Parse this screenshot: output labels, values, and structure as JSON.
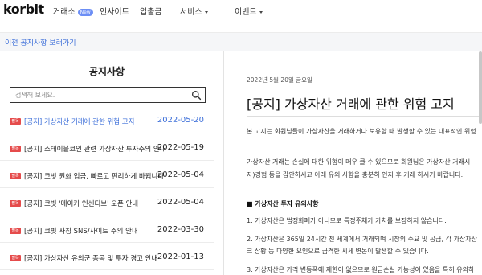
{
  "nav": {
    "logo": "korbit",
    "items": [
      {
        "label": "거래소",
        "badge": "New"
      },
      {
        "label": "인사이트"
      },
      {
        "label": "입출금"
      },
      {
        "label": "서비스"
      },
      {
        "label": "이벤트"
      }
    ]
  },
  "subbar": {
    "back_link": "이전 공지사항 보러가기"
  },
  "sidebar": {
    "title": "공지사항",
    "search_placeholder": "검색해 보세요.",
    "search_value": "",
    "items": [
      {
        "tag": "필독",
        "title": "[공지] 가상자산 거래에 관한 위험 고지",
        "date": "2022-05-20",
        "active": true
      },
      {
        "tag": "필독",
        "title": "[공지] 스테이블코인 관련 가상자산 투자주의 안내",
        "date": "2022-05-19"
      },
      {
        "tag": "필독",
        "title": "[공지] 코빗 원화 입금, 빠르고 편리하게 바뀝니다.",
        "date": "2022-05-04"
      },
      {
        "tag": "필독",
        "title": "[공지] 코빗 '메이커 인센티브' 오픈 안내",
        "date": "2022-05-04"
      },
      {
        "tag": "필독",
        "title": "[공지] 코빗 사칭 SNS/사이트 주의 안내",
        "date": "2022-03-30"
      },
      {
        "tag": "필독",
        "title": "[공지] 가상자산 유의군 종목 및 투자 경고 안내",
        "date": "2022-01-13"
      }
    ]
  },
  "post": {
    "date": "2022년 5월 20일 금요일",
    "title": "[공지] 가상자산 거래에 관한 위험 고지",
    "paragraphs": [
      "본 고지는 회원님들이 가상자산을 거래하거나 보유할 때 발생할 수 있는 대표적인 위험",
      "가상자산 거래는 손실에 대한 위험이 매우 클 수 있으므로 회원님은 가상자산 거래시",
      "자)경험 등을 감안하시고 아래 유의 사항을 충분히 인지 후 거래 하시기 바랍니다.",
      "■ 가상자산 투자 유의사항",
      "1. 가상자산은 법정화폐가 아니므로 특정주체가 가치를 보장하지 않습니다.",
      "2. 가상자산은 365일 24시간 전 세계에서 거래되며 시장의 수요 및 공급, 각 가상자산",
      "크 상황 등 다양한 요인으로 급격한 시세 변동이 발생할 수 있습니다.",
      "3. 가상자산은 가격 변동폭에 제한이 없으므로 원금손실 가능성이 있음을 특히 유의하"
    ]
  }
}
